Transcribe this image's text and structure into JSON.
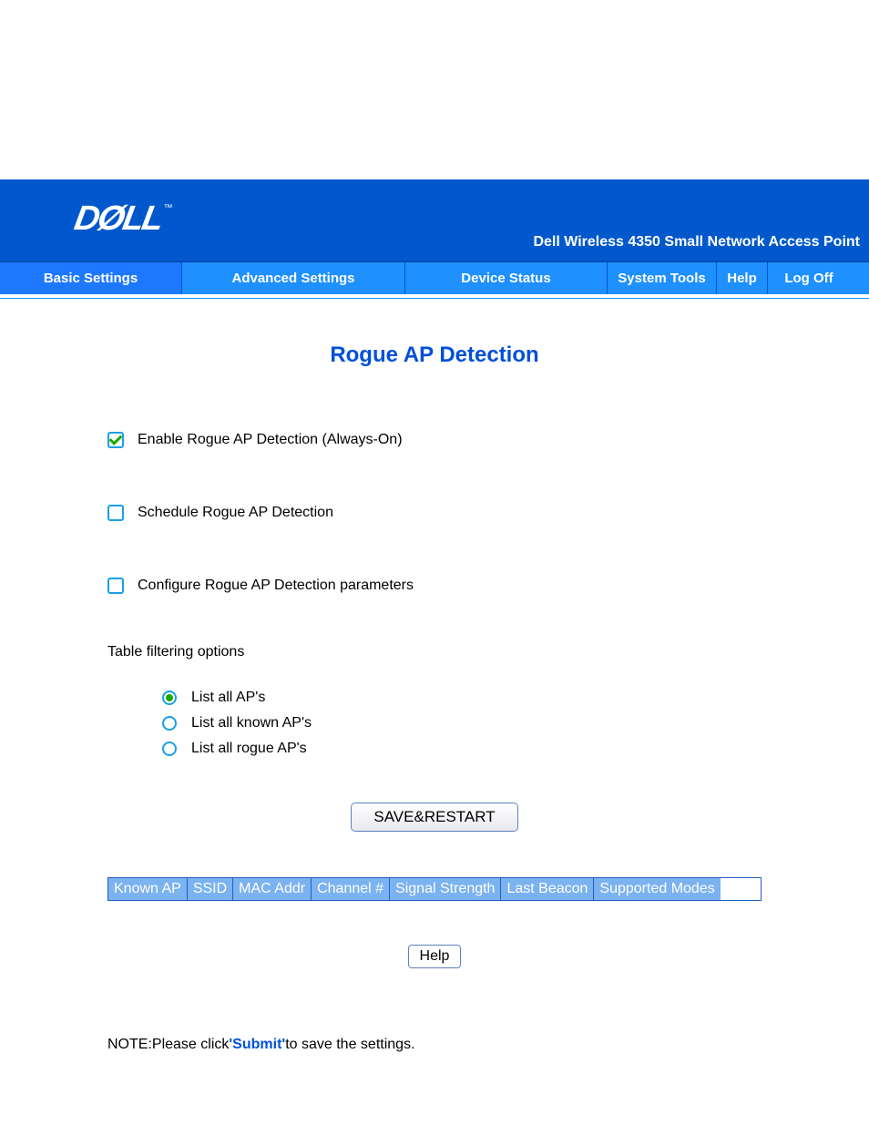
{
  "product_name": "Dell Wireless 4350 Small Network Access Point",
  "logo_text": "DØLL",
  "nav": {
    "basic": "Basic Settings",
    "advanced": "Advanced Settings",
    "device": "Device Status",
    "system": "System Tools",
    "help": "Help",
    "logoff": "Log Off"
  },
  "page_title": "Rogue AP Detection",
  "options": {
    "enable": {
      "label": "Enable Rogue AP Detection (Always-On)",
      "checked": true
    },
    "schedule": {
      "label": "Schedule Rogue AP Detection",
      "checked": false
    },
    "configure": {
      "label": "Configure Rogue AP Detection parameters",
      "checked": false
    }
  },
  "filtering": {
    "title": "Table filtering options",
    "radios": {
      "all": {
        "label": "List all AP's",
        "selected": true
      },
      "known": {
        "label": "List all known AP's",
        "selected": false
      },
      "rogue": {
        "label": "List all rogue AP's",
        "selected": false
      }
    }
  },
  "buttons": {
    "save": "SAVE&RESTART",
    "help": "Help"
  },
  "table": {
    "headers": [
      "Known AP",
      "SSID",
      "MAC Addr",
      "Channel #",
      "Signal Strength",
      "Last Beacon",
      "Supported Modes"
    ]
  },
  "note": {
    "prefix": "NOTE:Please click",
    "link": "'Submit'",
    "suffix": "to save the settings."
  }
}
